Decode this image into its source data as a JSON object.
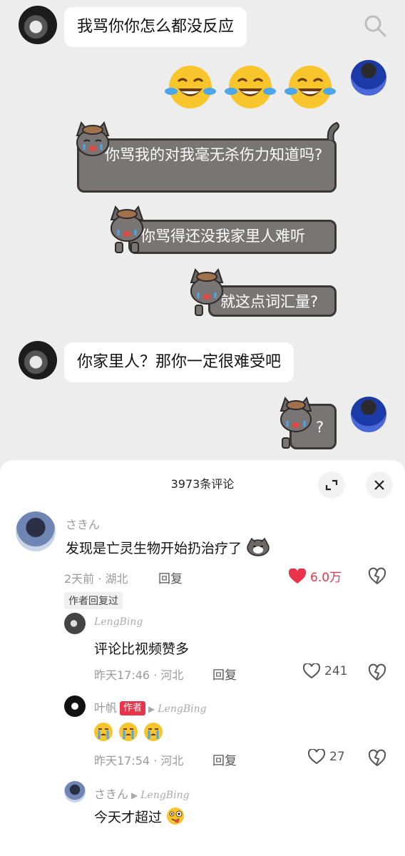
{
  "chat": {
    "messages": [
      {
        "side": "left",
        "text": "我骂你你怎么都没反应"
      },
      {
        "side": "right",
        "type": "emoji",
        "name": "laughing-crying-emoji",
        "count": 3
      },
      {
        "side": "right",
        "type": "sticker",
        "text": "你骂我的对我毫无杀伤力知道吗?"
      },
      {
        "side": "right",
        "type": "sticker",
        "text": "你骂得还没我家里人难听"
      },
      {
        "side": "right",
        "type": "sticker",
        "text": "就这点词汇量?"
      },
      {
        "side": "left",
        "text": "你家里人？那你一定很难受吧"
      },
      {
        "side": "right",
        "type": "sticker",
        "text": "?"
      }
    ]
  },
  "comments": {
    "count_label": "3973条评论",
    "top": {
      "user": "さきん",
      "text": "发现是亡灵生物开始扔治疗了",
      "time": "2天前",
      "location": "湖北",
      "reply_label": "回复",
      "likes": "6.0万",
      "author_replied": "作者回复过"
    },
    "replies": [
      {
        "user": "LengBing",
        "text": "评论比视频赞多",
        "time": "昨天17:46",
        "location": "河北",
        "reply_label": "回复",
        "likes": "241"
      },
      {
        "user": "叶帆",
        "badge": "作者",
        "reply_to": "LengBing",
        "text": "😭😭😭",
        "time": "昨天17:54",
        "location": "河北",
        "reply_label": "回复",
        "likes": "27"
      },
      {
        "user": "さきん",
        "reply_to": "LengBing",
        "text": "今天才超过"
      }
    ]
  },
  "colors": {
    "liked": "#e8334a",
    "sticker_bubble": "#7a7575",
    "chat_bg": "#ededed"
  }
}
